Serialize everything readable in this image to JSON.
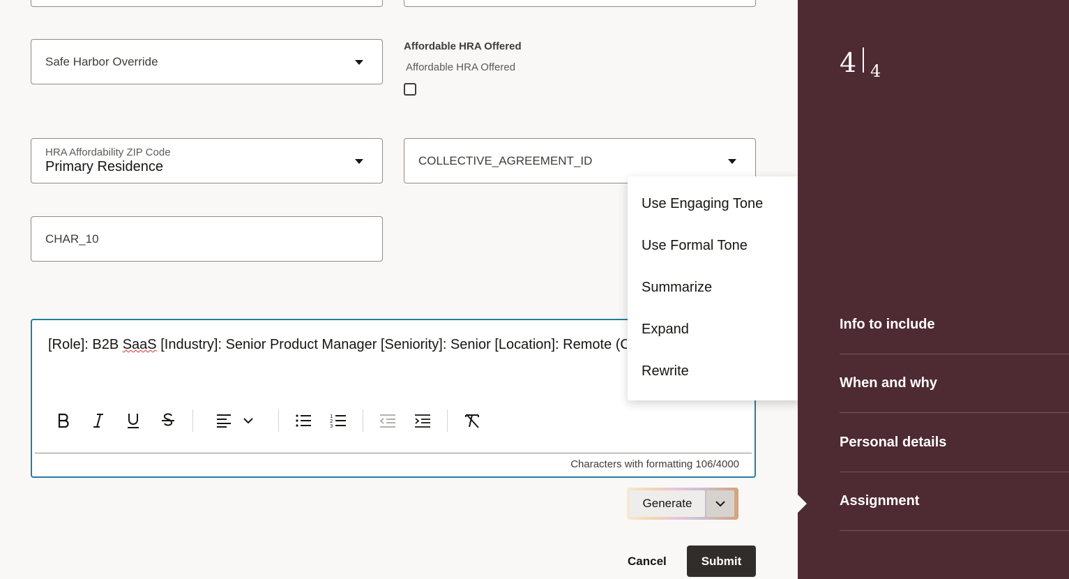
{
  "form": {
    "safe_harbor": {
      "value": "Safe Harbor Override"
    },
    "affordable_hra": {
      "title": "Affordable HRA Offered",
      "label": "Affordable HRA Offered",
      "checked": false
    },
    "hra_zip": {
      "label": "HRA Affordability ZIP Code",
      "value": "Primary Residence"
    },
    "collective_agreement": {
      "value": "COLLECTIVE_AGREEMENT_ID"
    },
    "char10": {
      "value": "CHAR_10"
    }
  },
  "editor": {
    "text_part1": "[Role]: B2B ",
    "text_misspelled": "SaaS",
    "text_part2": " [Industry]: Senior Product Manager [Seniority]: Senior [Location]: Remote (C",
    "counter": "Characters with formatting 106/4000",
    "generate_label": "Generate"
  },
  "menu": {
    "items": [
      "Use Engaging Tone",
      "Use Formal Tone",
      "Summarize",
      "Expand",
      "Rewrite"
    ]
  },
  "actions": {
    "cancel": "Cancel",
    "submit": "Submit"
  },
  "sidebar": {
    "step_current": "4",
    "step_total": "4",
    "items": [
      "Info to include",
      "When and why",
      "Personal details",
      "Assignment"
    ],
    "active": "Assignment"
  },
  "colors": {
    "sidebar_bg": "#4e2a32",
    "editor_focus": "#227e9e",
    "submit_bg": "#312d2a"
  }
}
